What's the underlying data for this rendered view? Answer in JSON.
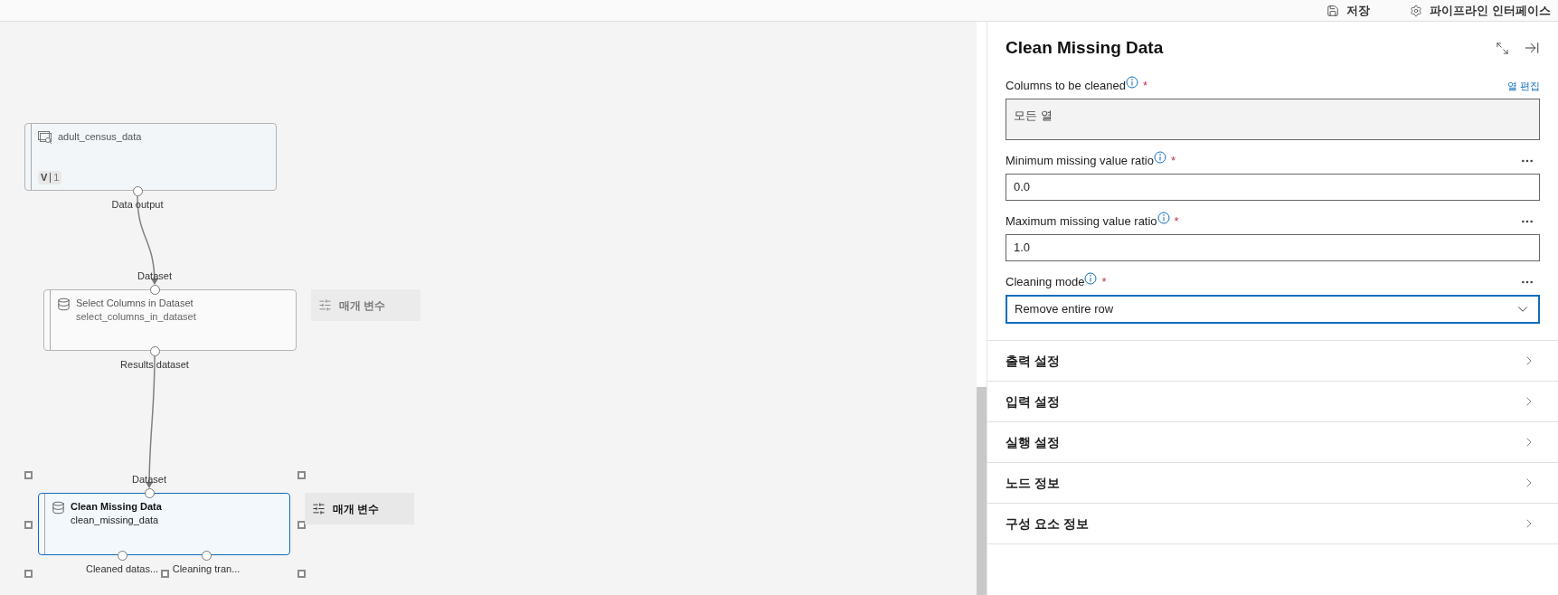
{
  "toolbar": {
    "buttons": [
      {
        "kind": "save",
        "label": "저장"
      },
      {
        "kind": "interface",
        "label": "파이프라인 인터페이스"
      }
    ]
  },
  "canvas": {
    "nodes": [
      {
        "kind": "dataset",
        "title": "adult_census_data",
        "version_label": "V",
        "version": "1",
        "outputs": [
          "Data output"
        ],
        "selected": false
      },
      {
        "kind": "component",
        "title": "Select Columns in Dataset",
        "subtitle": "select_columns_in_dataset",
        "inputs": [
          "Dataset"
        ],
        "outputs": [
          "Results dataset"
        ],
        "parameters_button": "매개 변수",
        "selected": false
      },
      {
        "kind": "component",
        "title": "Clean Missing Data",
        "subtitle": "clean_missing_data",
        "inputs": [
          "Dataset"
        ],
        "outputs": [
          "Cleaned datas...",
          "Cleaning tran..."
        ],
        "parameters_button": "매개 변수",
        "selected": true
      }
    ]
  },
  "panel": {
    "title": "Clean Missing Data",
    "fields": [
      {
        "kind": "readonly",
        "label": "Columns to be cleaned",
        "required_mark": "*",
        "link": "열 편집",
        "value": "모든 열"
      },
      {
        "kind": "text",
        "label": "Minimum missing value ratio",
        "required_mark": "*",
        "value": "0.0"
      },
      {
        "kind": "text",
        "label": "Maximum missing value ratio",
        "required_mark": "*",
        "value": "1.0"
      },
      {
        "kind": "select",
        "label": "Cleaning mode",
        "required_mark": "*",
        "value": "Remove entire row",
        "focused": true
      }
    ],
    "sections": [
      {
        "label": "출력 설정",
        "expanded": false
      },
      {
        "label": "입력 설정",
        "expanded": false
      },
      {
        "label": "실행 설정",
        "expanded": false
      },
      {
        "label": "노드 정보",
        "expanded": false
      },
      {
        "label": "구성 요소 정보",
        "expanded": false
      }
    ]
  }
}
